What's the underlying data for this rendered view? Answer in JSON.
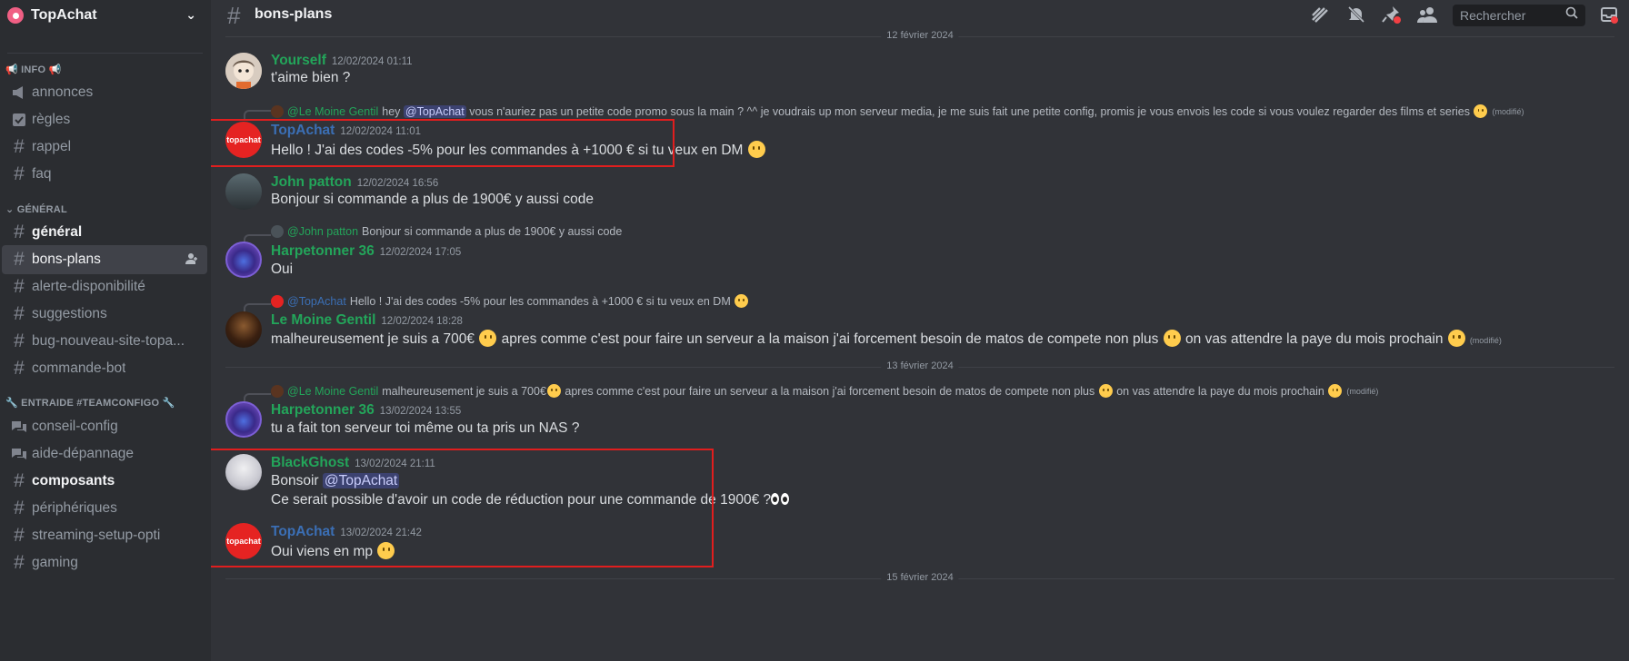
{
  "server": {
    "name": "TopAchat"
  },
  "sidebar": {
    "categories": {
      "info": "📢 INFO 📢",
      "general": "GÉNÉRAL",
      "entraide": "🔧 ENTRAIDE #TEAMCONFIGO 🔧"
    },
    "channels": [
      {
        "label": "annonces",
        "icon": "megaphone-icon"
      },
      {
        "label": "règles",
        "icon": "rules-icon"
      },
      {
        "label": "rappel",
        "icon": "hash-icon"
      },
      {
        "label": "faq",
        "icon": "hash-thread-icon"
      },
      {
        "label": "général",
        "icon": "hash-icon"
      },
      {
        "label": "bons-plans",
        "icon": "hash-icon"
      },
      {
        "label": "alerte-disponibilité",
        "icon": "hash-thread-icon"
      },
      {
        "label": "suggestions",
        "icon": "hash-icon"
      },
      {
        "label": "bug-nouveau-site-topa...",
        "icon": "hash-thread-icon"
      },
      {
        "label": "commande-bot",
        "icon": "hash-thread-icon"
      },
      {
        "label": "conseil-config",
        "icon": "forum-icon"
      },
      {
        "label": "aide-dépannage",
        "icon": "forum-icon"
      },
      {
        "label": "composants",
        "icon": "hash-thread-icon"
      },
      {
        "label": "périphériques",
        "icon": "hash-thread-icon"
      },
      {
        "label": "streaming-setup-opti",
        "icon": "hash-thread-icon"
      },
      {
        "label": "gaming",
        "icon": "hash-thread-icon"
      }
    ]
  },
  "header": {
    "channel": "bons-plans",
    "search_placeholder": "Rechercher"
  },
  "dividers": {
    "d1": "12 février 2024",
    "d2": "13 février 2024",
    "d3": "15 février 2024"
  },
  "messages": [
    {
      "author": "Yourself",
      "time": "12/02/2024 01:11",
      "text": "t'aime bien ?"
    },
    {
      "reply_author": "@Le Moine Gentil",
      "reply_pre": "hey",
      "reply_mention": "@TopAchat",
      "reply_post": "vous n'auriez pas un petite code promo sous la main ? ^^ je voudrais up mon serveur media, je me suis fait une petite config, promis je vous envois les code si vous voulez regarder des films et series",
      "edited": "(modifié)",
      "author": "TopAchat",
      "time": "12/02/2024 11:01",
      "text": "Hello ! J'ai des codes -5% pour les commandes à +1000 € si tu veux en DM"
    },
    {
      "author": "John patton",
      "time": "12/02/2024 16:56",
      "text": "Bonjour si commande a plus de 1900€ y aussi code"
    },
    {
      "reply_author": "@John patton",
      "reply_text": "Bonjour si commande a plus de 1900€ y aussi code",
      "author": "Harpetonner 36",
      "time": "12/02/2024 17:05",
      "text": "Oui"
    },
    {
      "reply_author": "@TopAchat",
      "reply_text": "Hello ! J'ai des codes -5% pour les commandes à +1000 € si tu veux en DM",
      "author": "Le Moine Gentil",
      "time": "12/02/2024 18:28",
      "text_a": "malheureusement je suis a 700€",
      "text_b": "apres comme c'est pour faire un serveur a la maison j'ai forcement besoin de matos de compete non plus",
      "text_c": "on vas attendre la paye du mois prochain",
      "edited": "(modifié)"
    },
    {
      "reply_author": "@Le Moine Gentil",
      "reply_a": "malheureusement je suis a 700€",
      "reply_b": "apres comme c'est pour faire un serveur a la maison j'ai forcement besoin de matos de compete non plus",
      "reply_c": "on vas attendre la paye du mois prochain",
      "edited": "(modifié)",
      "author": "Harpetonner 36",
      "time": "13/02/2024 13:55",
      "text": "tu a fait ton serveur toi même ou ta pris un NAS ?"
    },
    {
      "author": "BlackGhost",
      "time": "13/02/2024 21:11",
      "line1": "Bonsoir",
      "mention": "@TopAchat",
      "line2": "Ce serait possible d'avoir un code de réduction pour une commande de 1900€ ?"
    },
    {
      "author": "TopAchat",
      "time": "13/02/2024 21:42",
      "text": "Oui viens en mp"
    }
  ],
  "avatar_text": "topachat",
  "colors": {
    "highlight": "#e01e1e",
    "username_green": "#23a55a",
    "username_blue": "#3b6fb5"
  }
}
